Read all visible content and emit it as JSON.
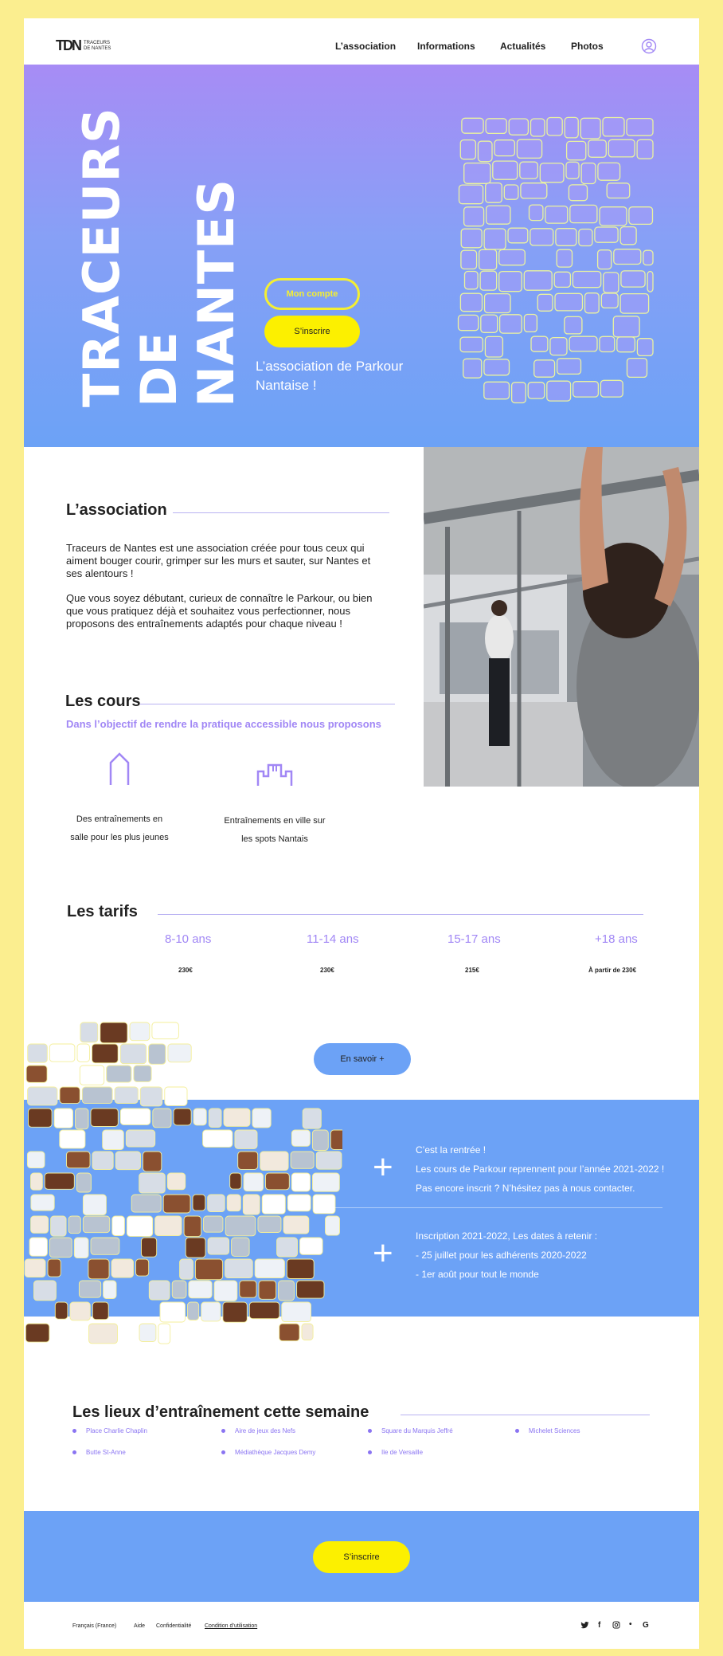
{
  "header": {
    "logo_mark": "TDN",
    "logo_line1": "TRACEURS",
    "logo_line2": "DE NANTES",
    "nav": [
      "L’association",
      "Informations",
      "Actualités",
      "Photos"
    ]
  },
  "hero": {
    "title_line1": "TRACEURS",
    "title_line2": "DE",
    "title_line3": "NANTES",
    "account_button": "Mon compte",
    "signup_button": "S’inscrire",
    "tagline": "L’association de Parkour Nantaise !"
  },
  "association": {
    "title": "L’association",
    "paragraph1": "Traceurs de Nantes est une association créée pour tous ceux qui aiment bouger courir, grimper sur les murs et sauter, sur Nantes et ses alentours !",
    "paragraph2": "Que vous soyez débutant, curieux de connaître le Parkour, ou bien que vous pratiquez déjà et souhaitez vous perfectionner, nous proposons des entraînements adaptés pour chaque niveau !"
  },
  "cours": {
    "title": "Les cours",
    "subtitle": "Dans l’objectif de rendre la pratique accessible nous proposons",
    "item1_line1": "Des entraînements en",
    "item1_line2": "salle pour les plus jeunes",
    "item2_line1": "Entraînements en ville sur",
    "item2_line2": "les spots Nantais"
  },
  "tarifs": {
    "title": "Les tarifs",
    "items": [
      {
        "age": "8-10 ans",
        "price": "230€"
      },
      {
        "age": "11-14 ans",
        "price": "230€"
      },
      {
        "age": "15-17 ans",
        "price": "215€"
      },
      {
        "age": "+18 ans",
        "price": "À partir de 230€"
      }
    ],
    "more_button": "En savoir +"
  },
  "news": {
    "block1": [
      "C’est la rentrée !",
      "Les cours de Parkour reprennent pour l’année 2021-2022 !",
      "Pas encore inscrit ? N’hésitez pas à nous contacter."
    ],
    "block2": [
      "Inscription 2021-2022, Les dates à retenir :",
      "- 25 juillet pour les adhérents 2020-2022",
      "- 1er août pour tout le monde"
    ]
  },
  "lieux": {
    "title": "Les lieux d’entraînement cette semaine",
    "items": [
      "Place Charlie Chaplin",
      "Aire de jeux des Nefs",
      "Square du Marquis Jeffré",
      "Michelet Sciences",
      "Butte St-Anne",
      "Médiathèque Jacques Demy",
      "Ile de Versaille"
    ]
  },
  "cta": {
    "button": "S’inscrire"
  },
  "footer": {
    "language": "Français (France)",
    "links": [
      "Aide",
      "Confidentialité",
      "Condition d’utilisation"
    ],
    "social_icons": [
      "twitter-icon",
      "facebook-icon",
      "instagram-icon",
      "dot-icon",
      "google-icon"
    ]
  },
  "colors": {
    "accent_purple": "#a187f5",
    "blue": "#6ca2f6",
    "yellow": "#fcf000",
    "frame_yellow": "#fbee8f"
  }
}
